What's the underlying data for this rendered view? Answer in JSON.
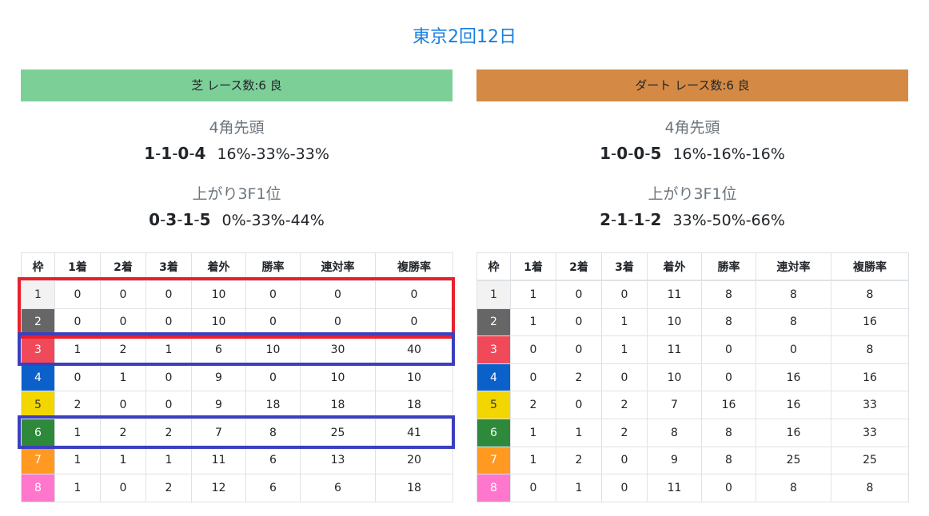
{
  "title": "東京2回12日",
  "waku_colors": [
    "#f2f2f2",
    "#666666",
    "#f04a5a",
    "#0b61c9",
    "#f2d600",
    "#2e8a3a",
    "#ff9922",
    "#ff77cc"
  ],
  "waku_text_colors": [
    "#333333",
    "#ffffff",
    "#ffffff",
    "#ffffff",
    "#333333",
    "#ffffff",
    "#ffffff",
    "#ffffff"
  ],
  "columns": [
    "枠",
    "1着",
    "2着",
    "3着",
    "着外",
    "勝率",
    "連対率",
    "複勝率"
  ],
  "panels": [
    {
      "header": "芝 レース数:6  良",
      "header_color": "#7dcf98",
      "stat1_label": "4角先頭",
      "stat1_record": [
        "1",
        "1",
        "0",
        "4"
      ],
      "stat1_pct": "16%-33%-33%",
      "stat2_label": "上がり3F1位",
      "stat2_record": [
        "0",
        "3",
        "1",
        "5"
      ],
      "stat2_pct": "0%-33%-44%",
      "rows": [
        [
          "1",
          "0",
          "0",
          "0",
          "10",
          "0",
          "0",
          "0"
        ],
        [
          "2",
          "0",
          "0",
          "0",
          "10",
          "0",
          "0",
          "0"
        ],
        [
          "3",
          "1",
          "2",
          "1",
          "6",
          "10",
          "30",
          "40"
        ],
        [
          "4",
          "0",
          "1",
          "0",
          "9",
          "0",
          "10",
          "10"
        ],
        [
          "5",
          "2",
          "0",
          "0",
          "9",
          "18",
          "18",
          "18"
        ],
        [
          "6",
          "1",
          "2",
          "2",
          "7",
          "8",
          "25",
          "41"
        ],
        [
          "7",
          "1",
          "1",
          "1",
          "11",
          "6",
          "13",
          "20"
        ],
        [
          "8",
          "1",
          "0",
          "2",
          "12",
          "6",
          "6",
          "18"
        ]
      ],
      "highlights": [
        {
          "color": "red",
          "rows": [
            1,
            2
          ]
        },
        {
          "color": "blue",
          "rows": [
            3
          ]
        },
        {
          "color": "blue",
          "rows": [
            6
          ]
        }
      ]
    },
    {
      "header": "ダート レース数:6  良",
      "header_color": "#d48a45",
      "stat1_label": "4角先頭",
      "stat1_record": [
        "1",
        "0",
        "0",
        "5"
      ],
      "stat1_pct": "16%-16%-16%",
      "stat2_label": "上がり3F1位",
      "stat2_record": [
        "2",
        "1",
        "1",
        "2"
      ],
      "stat2_pct": "33%-50%-66%",
      "rows": [
        [
          "1",
          "1",
          "0",
          "0",
          "11",
          "8",
          "8",
          "8"
        ],
        [
          "2",
          "1",
          "0",
          "1",
          "10",
          "8",
          "8",
          "16"
        ],
        [
          "3",
          "0",
          "0",
          "1",
          "11",
          "0",
          "0",
          "8"
        ],
        [
          "4",
          "0",
          "2",
          "0",
          "10",
          "0",
          "16",
          "16"
        ],
        [
          "5",
          "2",
          "0",
          "2",
          "7",
          "16",
          "16",
          "33"
        ],
        [
          "6",
          "1",
          "1",
          "2",
          "8",
          "8",
          "16",
          "33"
        ],
        [
          "7",
          "1",
          "2",
          "0",
          "9",
          "8",
          "25",
          "25"
        ],
        [
          "8",
          "0",
          "1",
          "0",
          "11",
          "0",
          "8",
          "8"
        ]
      ],
      "highlights": []
    }
  ]
}
